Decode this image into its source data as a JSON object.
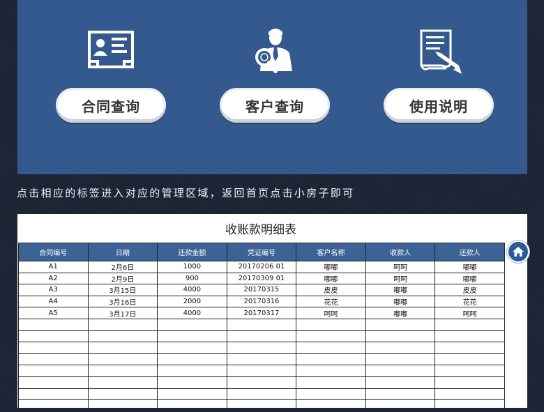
{
  "menu": {
    "contract_query": "合同查询",
    "customer_query": "客户查询",
    "instructions": "使用说明"
  },
  "instruction_text": "点击相应的标签进入对应的管理区域，返回首页点击小房子即可",
  "sheet": {
    "title": "收账款明细表",
    "columns": [
      "合同编号",
      "日期",
      "还款金额",
      "凭证编号",
      "客户名称",
      "收款人",
      "还款人"
    ],
    "rows": [
      [
        "A1",
        "2月6日",
        "1000",
        "20170206 01",
        "嘟嘟",
        "呵呵",
        "嘟嘟"
      ],
      [
        "A2",
        "2月9日",
        "900",
        "20170309 01",
        "嘟嘟",
        "呵呵",
        "嘟嘟"
      ],
      [
        "A3",
        "3月15日",
        "4000",
        "20170315",
        "皮皮",
        "嘟嘟",
        "皮皮"
      ],
      [
        "A4",
        "3月16日",
        "2000",
        "20170316",
        "花花",
        "嘟嘟",
        "花花"
      ],
      [
        "A5",
        "3月17日",
        "4000",
        "20170317",
        "呵呵",
        "嘟嘟",
        "呵呵"
      ]
    ],
    "empty_row_count": 8
  },
  "colors": {
    "panel": "#34598f",
    "table_header": "#3c6296",
    "home_button": "#2e5a9a"
  },
  "icons": {
    "contract": "id-card-icon",
    "customer": "person-magnifier-icon",
    "instructions": "document-pen-icon",
    "home": "home-icon"
  }
}
